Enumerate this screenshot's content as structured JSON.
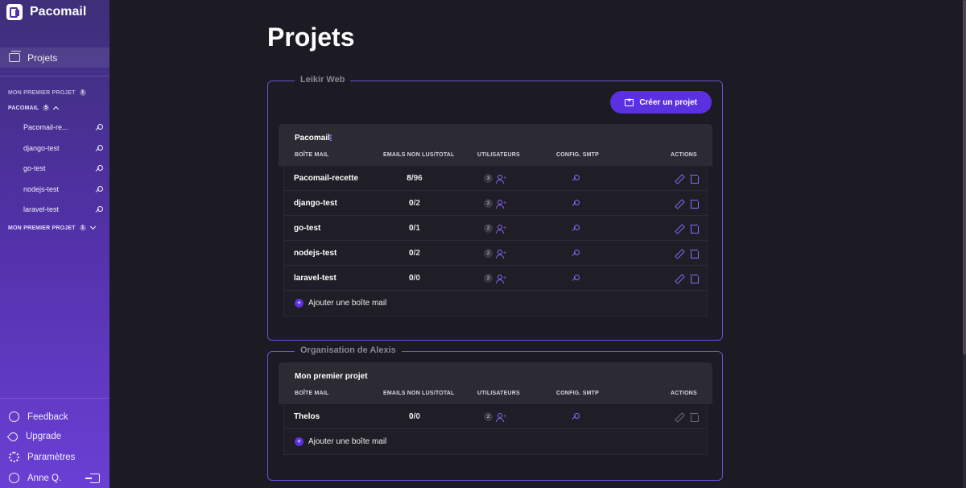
{
  "app": {
    "name": "Pacomail"
  },
  "sidebar": {
    "nav_projects": "Projets",
    "group1": {
      "label": "MON PREMIER PROJET",
      "count": "1"
    },
    "group2": {
      "label": "PACOMAIL",
      "count": "5"
    },
    "group2_items": [
      "Pacomail-re...",
      "django-test",
      "go-test",
      "nodejs-test",
      "laravel-test"
    ],
    "group3": {
      "label": "MON PREMIER PROJET",
      "count": "1"
    },
    "bottom": {
      "feedback": "Feedback",
      "upgrade": "Upgrade",
      "settings": "Paramètres",
      "user": "Anne Q."
    }
  },
  "page": {
    "title": "Projets"
  },
  "columns": {
    "mailbox": "BOÎTE MAIL",
    "emails": "EMAILS NON LUS/TOTAL",
    "users": "UTILISATEURS",
    "smtp": "CONFIG. SMTP",
    "actions": "ACTIONS"
  },
  "add_mailbox_label": "Ajouter une boîte mail",
  "create_project_label": "Créer un projet",
  "orgs": [
    {
      "name": "Leikir Web",
      "project": "Pacomail",
      "rows": [
        {
          "name": "Pacomail-recette",
          "unread": "8",
          "total": "/96",
          "users": "3"
        },
        {
          "name": "django-test",
          "unread": "0",
          "total": "/2",
          "users": "2"
        },
        {
          "name": "go-test",
          "unread": "0",
          "total": "/1",
          "users": "2"
        },
        {
          "name": "nodejs-test",
          "unread": "0",
          "total": "/2",
          "users": "2"
        },
        {
          "name": "laravel-test",
          "unread": "0",
          "total": "/0",
          "users": "2"
        }
      ]
    },
    {
      "name": "Organisation de Alexis",
      "project": "Mon premier projet",
      "rows": [
        {
          "name": "Thelos",
          "unread": "0",
          "total": "/0",
          "users": "2"
        }
      ]
    }
  ],
  "colors": {
    "accent": "#5b30e0",
    "border": "#6e4fd6",
    "icon": "#8c6bff"
  }
}
